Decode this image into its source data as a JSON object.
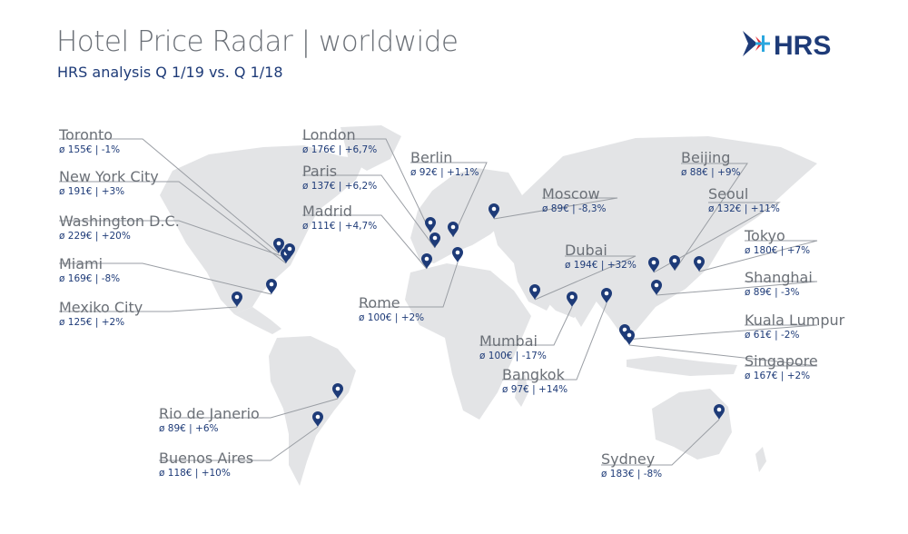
{
  "header": {
    "title": "Hotel Price Radar | worldwide",
    "subtitle": "HRS analysis Q 1/19 vs. Q 1/18"
  },
  "brand": {
    "logo_text": "HRS",
    "color_navy": "#1e3b78",
    "color_red": "#e3262d",
    "color_blue": "#2aa7df"
  },
  "colors": {
    "land": "#e3e4e6",
    "pin": "#1e3b78",
    "city_text": "#6b7077",
    "stats_text": "#1e3b78"
  },
  "cities": [
    {
      "name": "Toronto",
      "stats": "ø 155€ | -1%"
    },
    {
      "name": "New York City",
      "stats": "ø 191€ | +3%"
    },
    {
      "name": "Washington D.C.",
      "stats": "ø 229€ | +20%"
    },
    {
      "name": "Miami",
      "stats": "ø 169€ | -8%"
    },
    {
      "name": "Mexiko City",
      "stats": "ø 125€ | +2%"
    },
    {
      "name": "London",
      "stats": "ø 176€ | +6,7%"
    },
    {
      "name": "Paris",
      "stats": "ø 137€ | +6,2%"
    },
    {
      "name": "Madrid",
      "stats": "ø 111€ | +4,7%"
    },
    {
      "name": "Berlin",
      "stats": "ø 92€ | +1,1%"
    },
    {
      "name": "Moscow",
      "stats": "ø 89€ | -8,3%"
    },
    {
      "name": "Dubai",
      "stats": "ø 194€ | +32%"
    },
    {
      "name": "Rome",
      "stats": "ø 100€ | +2%"
    },
    {
      "name": "Mumbai",
      "stats": "ø 100€ | -17%"
    },
    {
      "name": "Bangkok",
      "stats": "ø 97€ | +14%"
    },
    {
      "name": "Beijing",
      "stats": "ø 88€ | +9%"
    },
    {
      "name": "Seoul",
      "stats": "ø 132€ | +11%"
    },
    {
      "name": "Tokyo",
      "stats": "ø 180€ | +7%"
    },
    {
      "name": "Shanghai",
      "stats": "ø 89€ | -3%"
    },
    {
      "name": "Kuala Lumpur",
      "stats": "ø 61€ | -2%"
    },
    {
      "name": "Singapore",
      "stats": "ø 167€ | +2%"
    },
    {
      "name": "Rio de Janerio",
      "stats": "ø 89€ | +6%"
    },
    {
      "name": "Buenos Aires",
      "stats": "ø 118€ | +10%"
    },
    {
      "name": "Sydney",
      "stats": "ø 183€ | -8%"
    }
  ]
}
